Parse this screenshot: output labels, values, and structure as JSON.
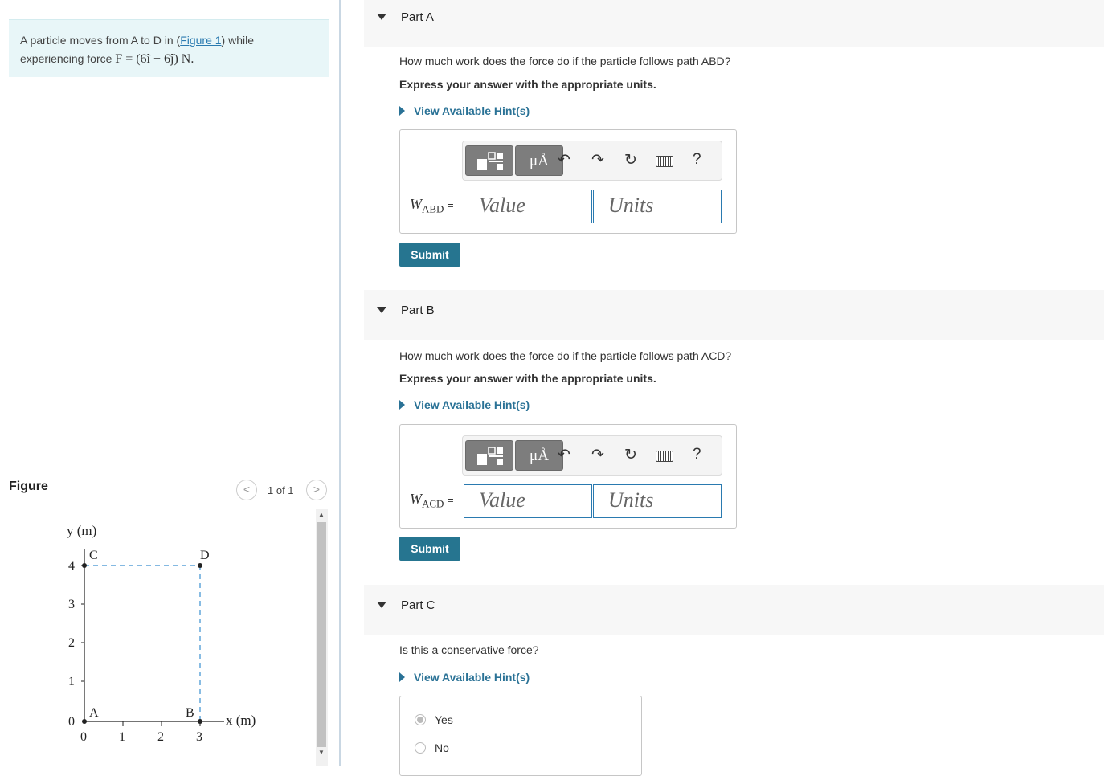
{
  "problem": {
    "text_before_link": "A particle moves from A to D in (",
    "link_text": "Figure 1",
    "text_after_link": ") while",
    "line2_prefix": "experiencing force ",
    "force_expression": "F = (6î + 6ĵ) N."
  },
  "figure_panel": {
    "title": "Figure",
    "pager_text": "1 of 1",
    "prev_icon": "chevron-left-icon",
    "next_icon": "chevron-right-icon",
    "y_axis_label": "y (m)",
    "x_axis_label": "x (m)",
    "x_ticks": [
      "0",
      "1",
      "2",
      "3"
    ],
    "y_ticks": [
      "0",
      "1",
      "2",
      "3",
      "4"
    ],
    "point_labels": {
      "A": "A",
      "B": "B",
      "C": "C",
      "D": "D"
    }
  },
  "parts": [
    {
      "title": "Part A",
      "question": "How much work does the force do if the particle follows path ABD?",
      "instruction": "Express your answer with the appropriate units.",
      "hint": "View Available Hint(s)",
      "var_main": "W",
      "var_sub": "ABD",
      "equals": "=",
      "value_placeholder": "Value",
      "units_placeholder": "Units",
      "submit": "Submit"
    },
    {
      "title": "Part B",
      "question": "How much work does the force do if the particle follows path ACD?",
      "instruction": "Express your answer with the appropriate units.",
      "hint": "View Available Hint(s)",
      "var_main": "W",
      "var_sub": "ACD",
      "equals": "=",
      "value_placeholder": "Value",
      "units_placeholder": "Units",
      "submit": "Submit"
    },
    {
      "title": "Part C",
      "question": "Is this a conservative force?",
      "hint": "View Available Hint(s)",
      "choices": [
        {
          "label": "Yes",
          "selected": true
        },
        {
          "label": "No",
          "selected": false
        }
      ]
    }
  ],
  "toolbar": {
    "mu_label": "μÅ",
    "help_label": "?",
    "icons": [
      "templates-icon",
      "units-icon",
      "undo-icon",
      "redo-icon",
      "reset-icon",
      "keyboard-icon",
      "help-icon"
    ]
  },
  "colors": {
    "accent": "#267590",
    "link": "#2a7ab0",
    "problem_bg": "#e8f6f8",
    "part_header_bg": "#f7f7f7"
  }
}
